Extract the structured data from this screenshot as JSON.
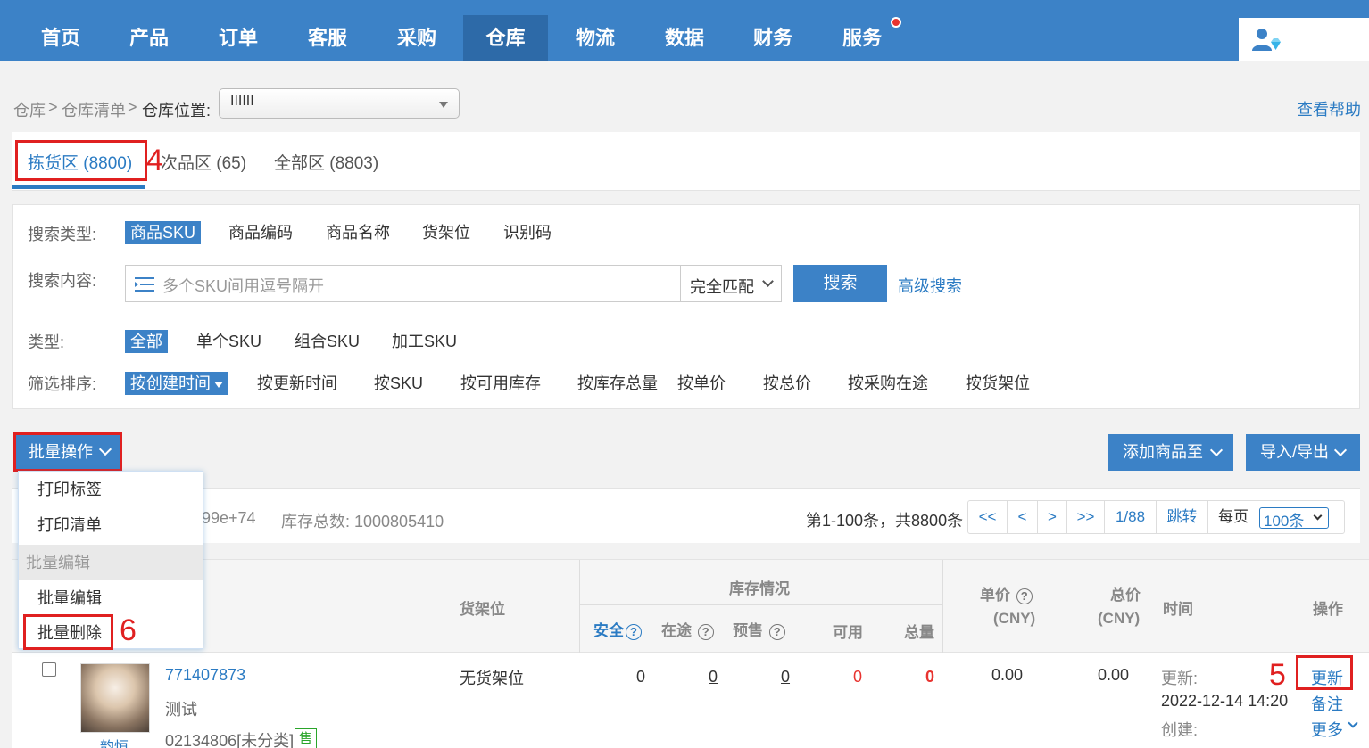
{
  "nav": {
    "items": [
      "首页",
      "产品",
      "订单",
      "客服",
      "采购",
      "仓库",
      "物流",
      "数据",
      "财务",
      "服务"
    ],
    "active_index": 5
  },
  "breadcrumb": {
    "level1": "仓库",
    "level2": "仓库清单",
    "location_label": "仓库位置:",
    "location_value": "IIIIII",
    "help_link": "查看帮助"
  },
  "tabs": [
    {
      "label": "拣货区 (8800)"
    },
    {
      "label": "次品区 (65)"
    },
    {
      "label": "全部区 (8803)"
    }
  ],
  "annotations": {
    "tab_marker": "4",
    "update_marker": "5",
    "delete_marker": "6"
  },
  "search": {
    "type_label": "搜索类型:",
    "types": [
      "商品SKU",
      "商品编码",
      "商品名称",
      "货架位",
      "识别码"
    ],
    "content_label": "搜索内容:",
    "placeholder": "多个SKU间用逗号隔开",
    "match_mode": "完全匹配",
    "search_button": "搜索",
    "advanced_link": "高级搜索",
    "kind_label": "类型:",
    "kinds": [
      "全部",
      "单个SKU",
      "组合SKU",
      "加工SKU"
    ],
    "sort_label": "筛选排序:",
    "sorts": [
      "按创建时间",
      "按更新时间",
      "按SKU",
      "按可用库存",
      "按库存总量",
      "按单价",
      "按总价",
      "按采购在途",
      "按货架位"
    ]
  },
  "actions": {
    "batch": "批量操作",
    "add_goods": "添加商品至",
    "import_export": "导入/导出"
  },
  "dropdown": {
    "print_label": "打印标签",
    "print_list": "打印清单",
    "group_title": "批量编辑",
    "batch_edit": "批量编辑",
    "batch_delete": "批量删除"
  },
  "info": {
    "total_value_tail": "99e+74",
    "stock_total": "库存总数: 1000805410",
    "range": "第1-100条，共8800条",
    "pager": {
      "first": "<<",
      "prev": "<",
      "next": ">",
      "last": ">>",
      "page": "1/88",
      "jump": "跳转",
      "per_page_label": "每页",
      "per_page_value": "100条"
    }
  },
  "table": {
    "headers": {
      "shelf": "货架位",
      "stock_group": "库存情况",
      "safe": "安全",
      "transit": "在途",
      "presale": "预售",
      "available": "可用",
      "total": "总量",
      "unit_price": "单价",
      "unit_price_cur": "(CNY)",
      "total_price": "总价",
      "total_price_cur": "(CNY)",
      "time": "时间",
      "ops": "操作"
    },
    "rows": [
      {
        "sku": "771407873",
        "name": "测试",
        "code": "02134806[未分类]",
        "badge": "售",
        "thumb_caption": "韵恒",
        "shelf": "无货架位",
        "safe": "0",
        "transit": "0",
        "presale": "0",
        "available": "0",
        "total": "0",
        "unit_price": "0.00",
        "total_price": "0.00",
        "updated_label": "更新:",
        "updated_at": "2022-12-14 14:20",
        "created_label": "创建:",
        "op_update": "更新",
        "op_note": "备注",
        "op_more": "更多"
      }
    ]
  },
  "colors": {
    "primary": "#3c82c7",
    "nav_active": "#2d6aa8",
    "link": "#2b7bc3",
    "alert": "#e02020",
    "zero_red": "#e8332f",
    "badge_green": "#2aa52a"
  }
}
